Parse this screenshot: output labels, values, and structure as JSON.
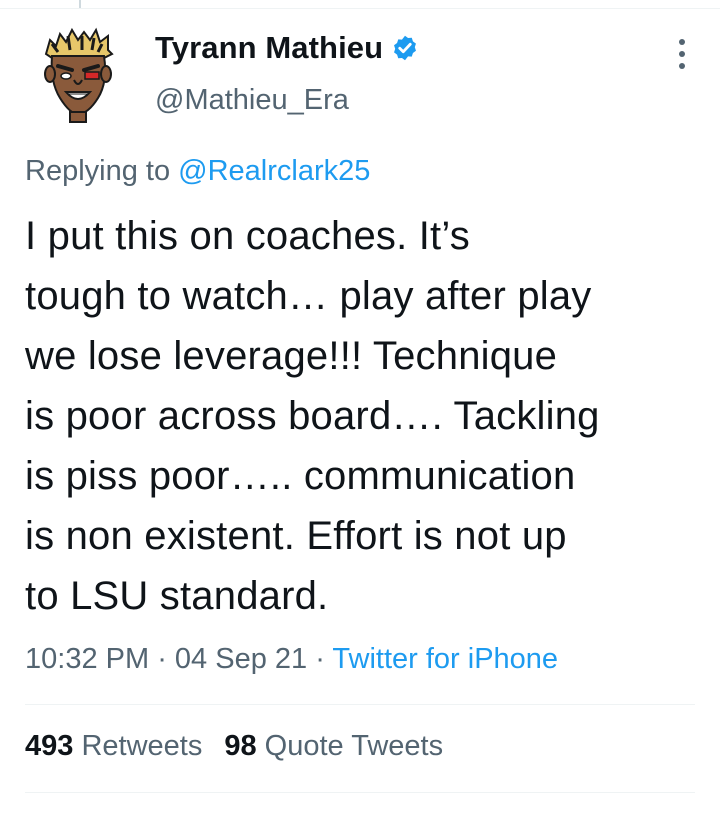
{
  "author": {
    "display_name": "Tyrann Mathieu",
    "handle": "@Mathieu_Era",
    "verified": true,
    "avatar": "cartoon-face-avatar"
  },
  "reply": {
    "prefix": "Replying to",
    "mention": "@Realrclark25"
  },
  "tweet": {
    "lines": [
      "I put this on coaches. It’s",
      "tough to watch… play after play",
      "we lose leverage!!! Technique",
      "is poor across board…. Tackling",
      "is piss poor….. communication",
      "is non existent. Effort is not up",
      "to LSU standard."
    ]
  },
  "meta": {
    "time": "10:32 PM",
    "separator": " · ",
    "date": "04 Sep 21",
    "source": "Twitter for iPhone"
  },
  "stats": {
    "retweets_count": "493",
    "retweets_label": "Retweets",
    "quotes_count": "98",
    "quotes_label": "Quote Tweets"
  },
  "icons": {
    "verified": "verified-badge-icon",
    "more": "more-options-icon"
  },
  "colors": {
    "link": "#1d9bf0",
    "secondary_text": "#536471",
    "primary_text": "#0f1419",
    "divider": "#eff3f4"
  }
}
